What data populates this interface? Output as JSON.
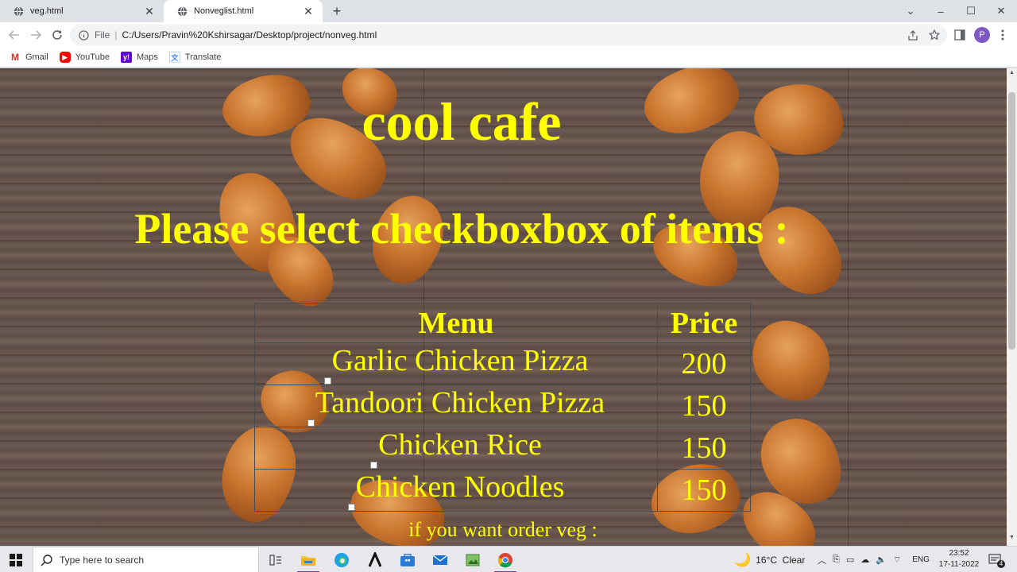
{
  "browser": {
    "tabs": [
      {
        "title": "veg.html",
        "active": false
      },
      {
        "title": "Nonveglist.html",
        "active": true
      }
    ],
    "omnibox": {
      "scheme": "File",
      "url": "C:/Users/Pravin%20Kshirsagar/Desktop/project/nonveg.html"
    },
    "profile_initial": "P",
    "bookmarks": [
      {
        "label": "Gmail",
        "icon": "gmail-icon"
      },
      {
        "label": "YouTube",
        "icon": "youtube-icon"
      },
      {
        "label": "Maps",
        "icon": "yahoo-icon"
      },
      {
        "label": "Translate",
        "icon": "translate-icon"
      }
    ]
  },
  "page": {
    "title": "cool cafe",
    "prompt": "Please select checkboxbox of items :",
    "menu_table": {
      "headers": [
        "Menu",
        "Price"
      ],
      "rows": [
        {
          "item": "Garlic Chicken Pizza",
          "price": "200"
        },
        {
          "item": "Tandoori Chicken Pizza",
          "price": "150"
        },
        {
          "item": "Chicken Rice",
          "price": "150"
        },
        {
          "item": "Chicken Noodles",
          "price": "150"
        }
      ]
    },
    "veg_prompt": "if you want order veg :"
  },
  "taskbar": {
    "search_placeholder": "Type here to search",
    "weather": "16°C  Clear",
    "language": "ENG",
    "time": "23:52",
    "date": "17-11-2022",
    "notification_count": "4"
  },
  "colors": {
    "accent_text": "#ffff00",
    "profile": "#7e57c2"
  }
}
